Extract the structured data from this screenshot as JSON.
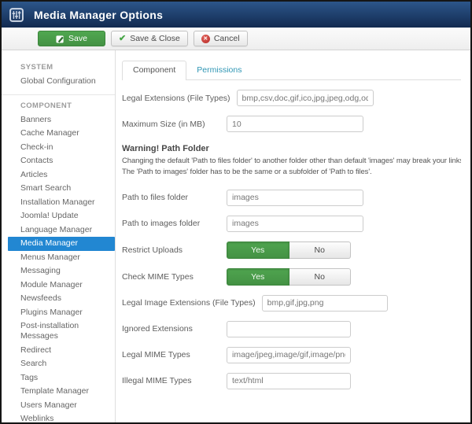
{
  "header": {
    "title": "Media Manager Options"
  },
  "toolbar": {
    "save": "Save",
    "save_close": "Save & Close",
    "cancel": "Cancel"
  },
  "sidebar": {
    "system_header": "SYSTEM",
    "system_items": [
      {
        "label": "Global Configuration"
      }
    ],
    "component_header": "COMPONENT",
    "component_items": [
      {
        "label": "Banners",
        "active": false
      },
      {
        "label": "Cache Manager",
        "active": false
      },
      {
        "label": "Check-in",
        "active": false
      },
      {
        "label": "Contacts",
        "active": false
      },
      {
        "label": "Articles",
        "active": false
      },
      {
        "label": "Smart Search",
        "active": false
      },
      {
        "label": "Installation Manager",
        "active": false
      },
      {
        "label": "Joomla! Update",
        "active": false
      },
      {
        "label": "Language Manager",
        "active": false
      },
      {
        "label": "Media Manager",
        "active": true
      },
      {
        "label": "Menus Manager",
        "active": false
      },
      {
        "label": "Messaging",
        "active": false
      },
      {
        "label": "Module Manager",
        "active": false
      },
      {
        "label": "Newsfeeds",
        "active": false
      },
      {
        "label": "Plugins Manager",
        "active": false
      },
      {
        "label": "Post-installation Messages",
        "active": false
      },
      {
        "label": "Redirect",
        "active": false
      },
      {
        "label": "Search",
        "active": false
      },
      {
        "label": "Tags",
        "active": false
      },
      {
        "label": "Template Manager",
        "active": false
      },
      {
        "label": "Users Manager",
        "active": false
      },
      {
        "label": "Weblinks",
        "active": false
      }
    ]
  },
  "tabs": [
    {
      "label": "Component",
      "active": true
    },
    {
      "label": "Permissions",
      "active": false
    }
  ],
  "form": {
    "rows": [
      {
        "label": "Legal Extensions (File Types)",
        "type": "text",
        "value": "bmp,csv,doc,gif,ico,jpg,jpeg,odg,odp"
      },
      {
        "label": "Maximum Size (in MB)",
        "type": "text",
        "value": "10"
      },
      {
        "label": "Path to files folder",
        "type": "text",
        "value": "images"
      },
      {
        "label": "Path to images folder",
        "type": "text",
        "value": "images"
      },
      {
        "label": "Restrict Uploads",
        "type": "toggle",
        "value": "Yes",
        "options": [
          "Yes",
          "No"
        ]
      },
      {
        "label": "Check MIME Types",
        "type": "toggle",
        "value": "Yes",
        "options": [
          "Yes",
          "No"
        ]
      },
      {
        "label": "Legal Image Extensions (File Types)",
        "type": "text",
        "value": "bmp,gif,jpg,png"
      },
      {
        "label": "Ignored Extensions",
        "type": "text",
        "value": ""
      },
      {
        "label": "Legal MIME Types",
        "type": "text",
        "value": "image/jpeg,image/gif,image/png,image/bmp"
      },
      {
        "label": "Illegal MIME Types",
        "type": "text",
        "value": "text/html"
      }
    ],
    "warning": {
      "title": "Warning! Path Folder",
      "line1": "Changing the default 'Path to files folder' to another folder other than default 'images' may break your links.",
      "line2": "The 'Path to images' folder has to be the same or a subfolder of 'Path to files'."
    }
  },
  "colors": {
    "header_gradient_top": "#2c568a",
    "header_gradient_bottom": "#122a50",
    "save_green": "#46a546",
    "sidebar_active_blue": "#2287d2",
    "tab_link_blue": "#2f96b4",
    "cancel_red": "#b52b27"
  }
}
